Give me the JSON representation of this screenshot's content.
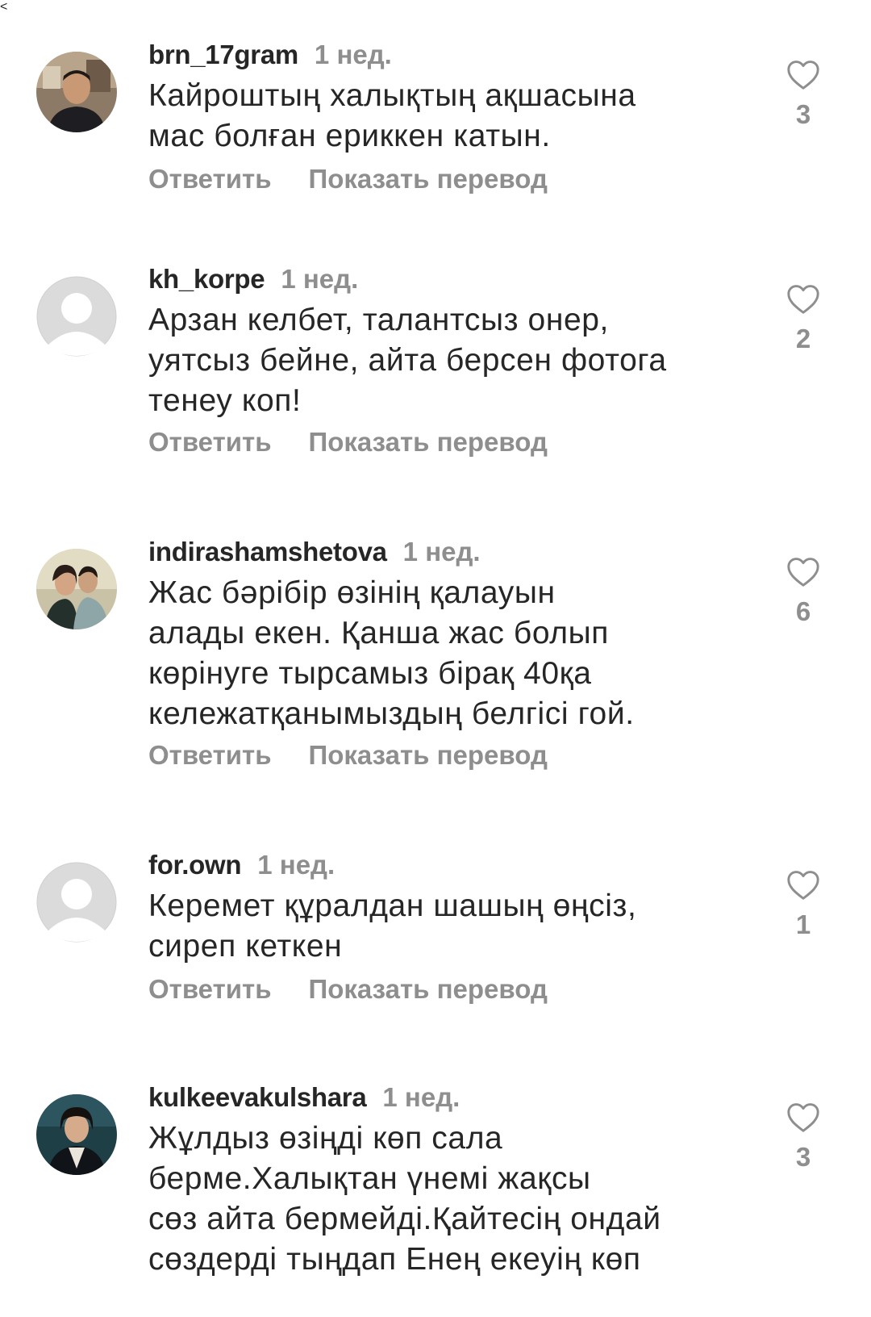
{
  "comments": [
    {
      "username": "brn_17gram",
      "time": "1 нед.",
      "text": "Кайроштың халықтың ақшасына\nмас болған ериккен катын.",
      "reply_label": "Ответить",
      "translate_label": "Показать перевод",
      "likes": "3",
      "avatar": "photo-man"
    },
    {
      "username": "kh_korpe",
      "time": "1 нед.",
      "text": "Арзан келбет, талантсыз онер,\nуятсыз бейне, айта берсен фотога\nтенеу коп!",
      "reply_label": "Ответить",
      "translate_label": "Показать перевод",
      "likes": "2",
      "avatar": "default-avatar-icon"
    },
    {
      "username": "indirashamshetova",
      "time": "1 нед.",
      "text": "Жас бәрібір өзінің қалауын\nалады екен. Қанша жас болып\nкөрінуге тырсамыз бірақ 40қа\nкележатқанымыздың белгісі гой.",
      "reply_label": "Ответить",
      "translate_label": "Показать перевод",
      "likes": "6",
      "avatar": "photo-couple"
    },
    {
      "username": "for.own",
      "time": "1 нед.",
      "text": "Керемет құралдан шашың өңсіз,\nсиреп кеткен",
      "reply_label": "Ответить",
      "translate_label": "Показать перевод",
      "likes": "1",
      "avatar": "default-avatar-icon"
    },
    {
      "username": "kulkeevakulshara",
      "time": "1 нед.",
      "text": "Жұлдыз өзіңді көп сала\nберме.Халықтан  үнемі жақсы\nсөз айта бермейді.Қайтесің ондай\nсөздерді тыңдап Енең екеуің көп",
      "reply_label": "",
      "translate_label": "",
      "likes": "3",
      "avatar": "photo-woman"
    }
  ],
  "colors": {
    "text": "#262626",
    "secondary": "#8e8e8e",
    "avatar_placeholder_bg": "#dbdbdb",
    "background": "#ffffff"
  }
}
